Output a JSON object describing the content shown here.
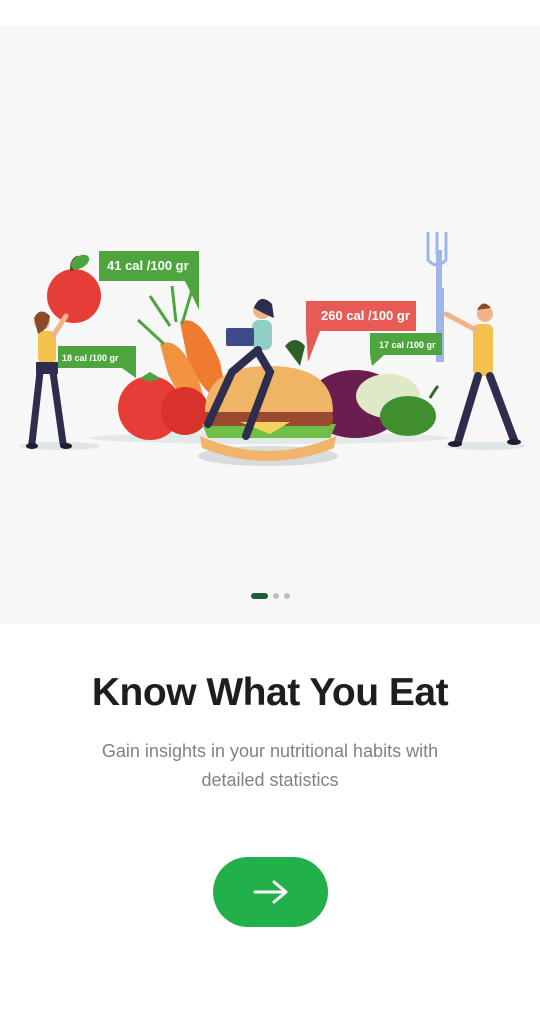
{
  "onboarding": {
    "title": "Know What You Eat",
    "subtitle_line1": "Gain insights in your nutritional habits with",
    "subtitle_line2": "detailed statistics",
    "page_count": 3,
    "current_page": 1
  },
  "illustration": {
    "label_apple": "41 cal /100 gr",
    "label_tomato": "18 cal /100 gr",
    "label_burger": "260 cal /100 gr",
    "label_pepper": "17 cal /100 gr"
  },
  "colors": {
    "accent": "#22b04b",
    "hero_bg": "#f7f7f7",
    "label_green": "#4ea53d",
    "label_red": "#e85a55"
  },
  "icons": {
    "next": "arrow-right-icon"
  }
}
